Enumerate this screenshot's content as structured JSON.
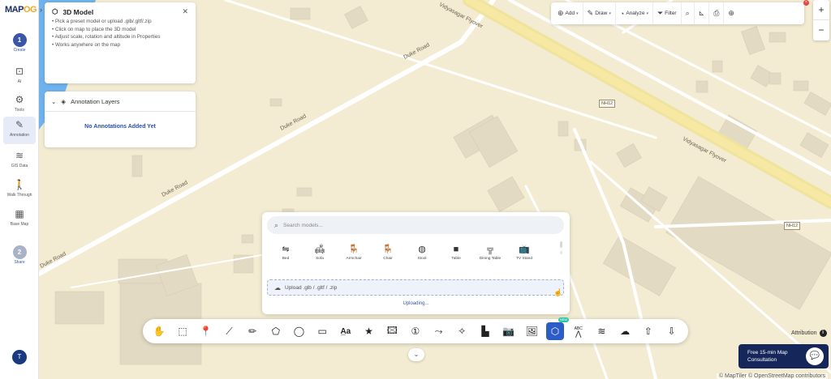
{
  "app": {
    "logo_main": "MAP",
    "logo_accent": "OG"
  },
  "sidebar": {
    "items": [
      {
        "label": "Create",
        "badge": "1",
        "icon": "step-one-badge"
      },
      {
        "label": "AI",
        "icon": "ai-icon"
      },
      {
        "label": "Tools",
        "icon": "tools-icon"
      },
      {
        "label": "Annotation",
        "icon": "annotation-brush-icon"
      },
      {
        "label": "GIS Data",
        "icon": "gis-data-icon"
      },
      {
        "label": "Walk Through",
        "icon": "walk-through-icon"
      },
      {
        "label": "Base Map",
        "icon": "base-map-icon"
      },
      {
        "label": "Share",
        "badge": "2",
        "icon": "step-two-badge"
      }
    ],
    "user_initial": "T"
  },
  "model_panel": {
    "title": "3D Model",
    "instructions": [
      "• Pick a preset model or upload .glb/.gltf/.zip",
      "• Click on map to place the 3D model",
      "• Adjust scale, rotation and altitude in Properties",
      "• Works anywhere on the map"
    ]
  },
  "layers_panel": {
    "title": "Annotation Layers",
    "empty_message": "No Annotations Added Yet"
  },
  "top_toolbar": {
    "add": "Add",
    "draw": "Draw",
    "analyze": "Analyze",
    "filter": "Filter"
  },
  "picker": {
    "search_placeholder": "Search models...",
    "models": [
      {
        "label": "Bed",
        "icon": "bed-icon",
        "glyph": "⇋"
      },
      {
        "label": "Sofa",
        "icon": "sofa-icon",
        "glyph": "🛋"
      },
      {
        "label": "Armchair",
        "icon": "armchair-icon",
        "glyph": "🪑"
      },
      {
        "label": "Chair",
        "icon": "chair-icon",
        "glyph": "🪑"
      },
      {
        "label": "Stool",
        "icon": "stool-icon",
        "glyph": "◍"
      },
      {
        "label": "Table",
        "icon": "table-icon",
        "glyph": "■"
      },
      {
        "label": "Dining Table",
        "icon": "dining-table-icon",
        "glyph": "╦"
      },
      {
        "label": "TV Stand",
        "icon": "tv-stand-icon",
        "glyph": "📺"
      }
    ],
    "upload_label": "Upload .glb / .gltf / .zip",
    "status": "Uploading..."
  },
  "map": {
    "roads": {
      "duke_1": "Duke Road",
      "duke_2": "Duke Road",
      "duke_3": "Duke Road",
      "duke_4": "Duke Road",
      "flyover_1": "Vidyasagar Flyover",
      "flyover_2": "Vidyasagar Flyover"
    },
    "shields": [
      "NH12",
      "NH12"
    ],
    "credit": "© MapTiler © OpenStreetMap contributors",
    "colors": {
      "land": "#f3ecd3",
      "water": "#6fb3ee",
      "flyover": "#f0dc8c",
      "building": "#e0d8c0"
    }
  },
  "bottom_toolbar": {
    "tools": [
      "pan-hand-icon",
      "select-area-icon",
      "marker-pin-icon",
      "line-icon",
      "pen-icon",
      "polygon-icon",
      "circle-icon",
      "rectangle-icon",
      "text-icon",
      "star-icon",
      "image-icon",
      "number-marker-icon",
      "route-icon",
      "freehand-shape-icon",
      "building-icon",
      "camera-icon",
      "photo-icon",
      "3d-model-icon",
      "label-icon",
      "wind-icon",
      "weather-icon",
      "share-upload-icon",
      "download-icon"
    ],
    "new_badge": "NEW",
    "label_tool_text": "ABC"
  },
  "attribution_label": "Attribution",
  "consult": {
    "line1": "Free 15-min Map",
    "line2": "Consultation"
  }
}
